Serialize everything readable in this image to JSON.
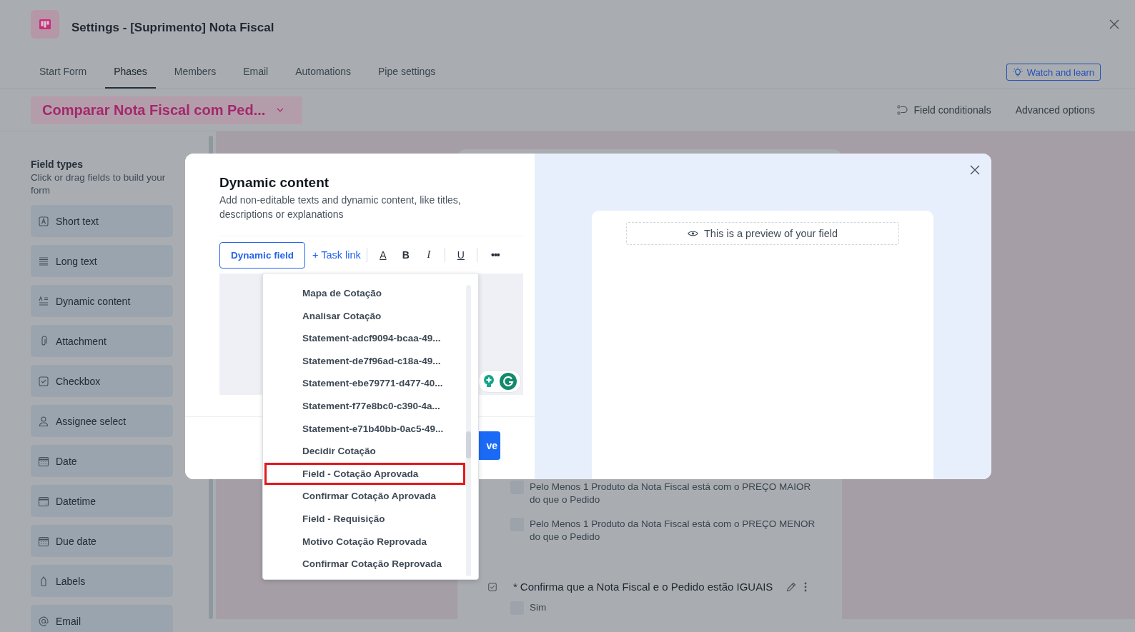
{
  "header": {
    "title": "Settings - [Suprimento] Nota Fiscal"
  },
  "tabs": [
    {
      "label": "Start Form",
      "selected": false
    },
    {
      "label": "Phases",
      "selected": true
    },
    {
      "label": "Members",
      "selected": false
    },
    {
      "label": "Email",
      "selected": false
    },
    {
      "label": "Automations",
      "selected": false
    },
    {
      "label": "Pipe settings",
      "selected": false
    }
  ],
  "watch_button": "Watch and learn",
  "phase": {
    "name": "Comparar Nota Fiscal com Ped..."
  },
  "phase_actions": [
    {
      "kind": "conditionals",
      "label": "Field conditionals"
    },
    {
      "kind": "advanced",
      "label": "Advanced options"
    }
  ],
  "sidebar": {
    "title": "Field types",
    "subtitle": "Click or drag fields to build your form",
    "items": [
      {
        "kind": "short_text",
        "label": "Short text"
      },
      {
        "kind": "long_text",
        "label": "Long text"
      },
      {
        "kind": "dynamic",
        "label": "Dynamic content"
      },
      {
        "kind": "attachment",
        "label": "Attachment"
      },
      {
        "kind": "checkbox",
        "label": "Checkbox"
      },
      {
        "kind": "assignee",
        "label": "Assignee select"
      },
      {
        "kind": "date",
        "label": "Date"
      },
      {
        "kind": "datetime",
        "label": "Datetime"
      },
      {
        "kind": "due_date",
        "label": "Due date"
      },
      {
        "kind": "labels",
        "label": "Labels"
      },
      {
        "kind": "email",
        "label": "Email"
      }
    ]
  },
  "form": {
    "options": [
      {
        "label": "Pelo Menos 1 Produto da Nota Fiscal está com o PREÇO MAIOR do que o Pedido",
        "checked": false
      },
      {
        "label": "Pelo Menos 1 Produto da Nota Fiscal está com o PREÇO MENOR do que o Pedido",
        "checked": false
      }
    ],
    "question": {
      "required_mark": "*",
      "label": "Confirma que a Nota Fiscal e o Pedido estão IGUAIS",
      "options": [
        {
          "label": "Sim",
          "checked": false
        }
      ]
    }
  },
  "modal": {
    "title": "Dynamic content",
    "description": "Add non-editable texts and dynamic content, like titles, descriptions or explanations",
    "toolbar": {
      "dynamic_field": "Dynamic field",
      "task_link": "+ Task link",
      "tools": [
        {
          "kind": "color",
          "label": "A"
        },
        {
          "kind": "bold",
          "label": "B"
        },
        {
          "kind": "italic",
          "label": "I"
        },
        {
          "kind": "underline",
          "label": "U"
        },
        {
          "kind": "more",
          "label": "•••"
        }
      ]
    },
    "save_button": "ve",
    "preview": "This is a preview of your field"
  },
  "dropdown": {
    "items": [
      {
        "label": "Mapa de Cotação",
        "selected": false
      },
      {
        "label": "Analisar Cotação",
        "selected": false
      },
      {
        "label": "Statement-adcf9094-bcaa-49...",
        "selected": false
      },
      {
        "label": "Statement-de7f96ad-c18a-49...",
        "selected": false
      },
      {
        "label": "Statement-ebe79771-d477-40...",
        "selected": false
      },
      {
        "label": "Statement-f77e8bc0-c390-4a...",
        "selected": false
      },
      {
        "label": "Statement-e71b40bb-0ac5-49...",
        "selected": false
      },
      {
        "label": "Decidir Cotação",
        "selected": false
      },
      {
        "label": "Field - Cotação Aprovada",
        "selected": true
      },
      {
        "label": "Confirmar Cotação Aprovada",
        "selected": false
      },
      {
        "label": "Field - Requisição",
        "selected": false
      },
      {
        "label": "Motivo Cotação Reprovada",
        "selected": false
      },
      {
        "label": "Confirmar Cotação Reprovada",
        "selected": false
      }
    ]
  }
}
